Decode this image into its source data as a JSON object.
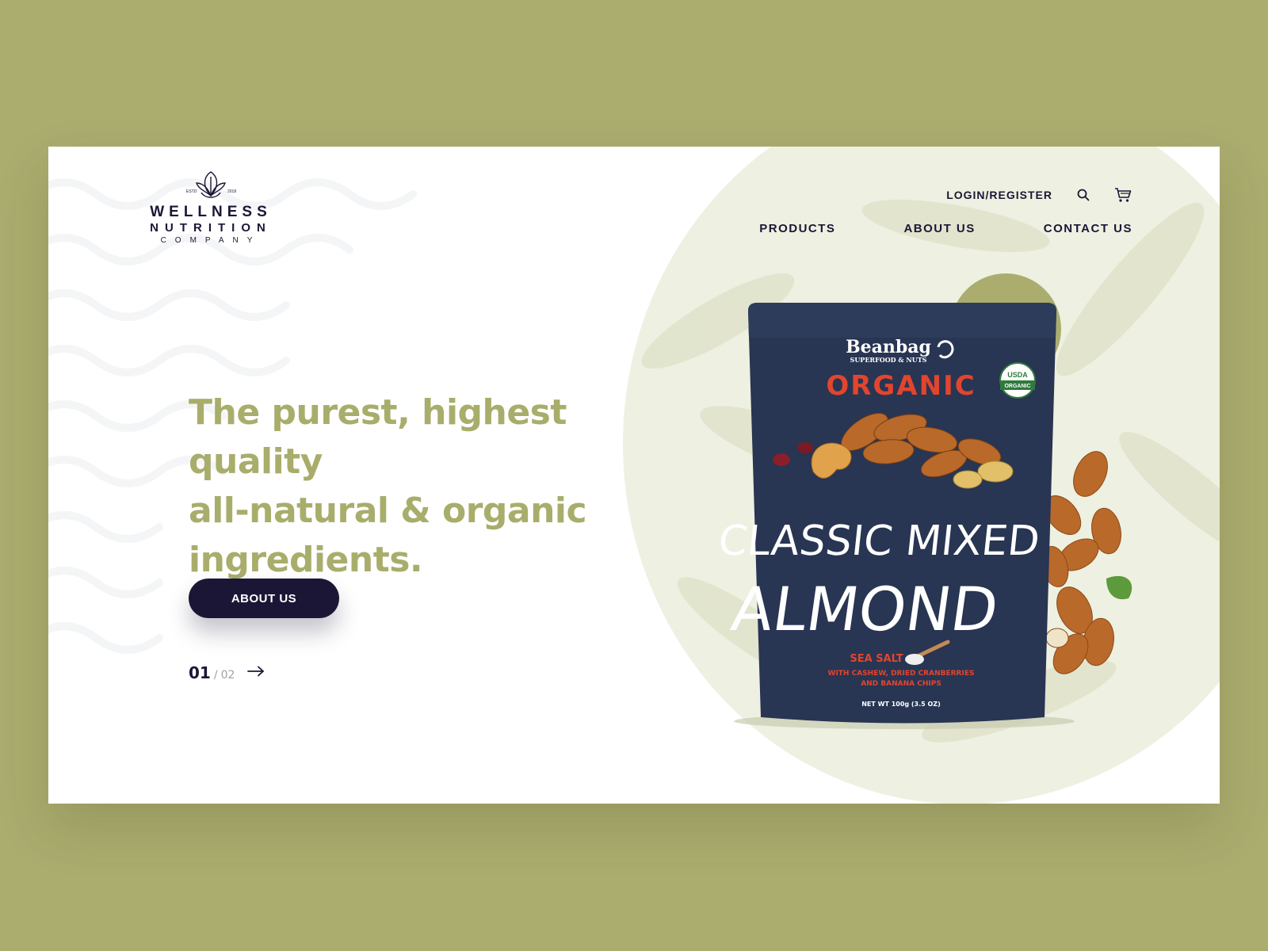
{
  "page": {
    "background": "#abad6f",
    "card_background": "#ffffff",
    "accent": "#a9ad6b",
    "dark": "#1c1636"
  },
  "logo": {
    "line1": "WELLNESS",
    "line2": "NUTRITION",
    "line3": "COMPANY",
    "est_left": "ESTD",
    "est_right": "2018",
    "icon": "leaf-crest-icon"
  },
  "header": {
    "login_label": "LOGIN/REGISTER",
    "search_icon": "search-icon",
    "cart_icon": "cart-icon"
  },
  "nav": {
    "items": [
      {
        "label": "PRODUCTS"
      },
      {
        "label": "ABOUT US"
      },
      {
        "label": "CONTACT US"
      }
    ]
  },
  "hero": {
    "heading_line1": "The purest, highest quality",
    "heading_line2": "all-natural & organic",
    "heading_line3": "ingredients.",
    "cta_label": "ABOUT US",
    "pager_current": "01",
    "pager_separator": "/",
    "pager_total": "02"
  },
  "product": {
    "brand": "Beanbag",
    "brand_tagline": "SUPERFOOD & NUTS",
    "organic_label": "ORGANIC",
    "usda_top": "USDA",
    "usda_bottom": "ORGANIC",
    "name_line1": "CLASSIC MIXED",
    "name_line2": "ALMOND",
    "flavor": "SEA SALT",
    "description_line1": "WITH CASHEW, DRIED CRANBERRIES",
    "description_line2": "AND BANANA CHIPS",
    "net_weight": "NET WT 100g (3.5 OZ)",
    "pouch_color": "#283553",
    "organic_color": "#e2452d"
  }
}
